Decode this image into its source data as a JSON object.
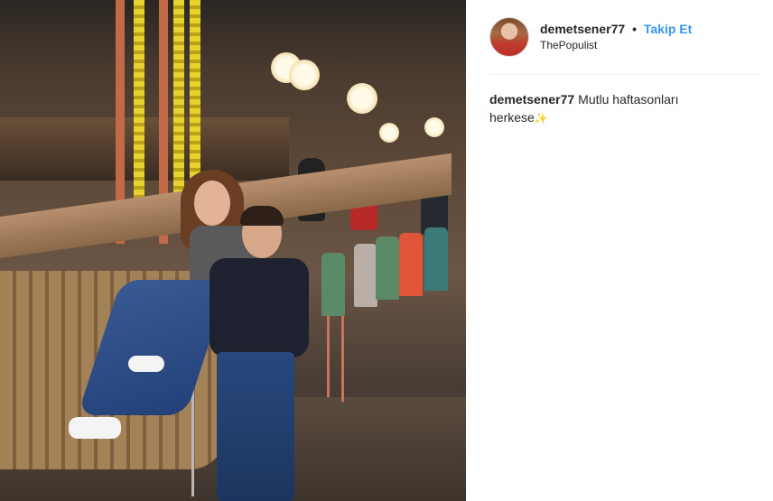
{
  "post": {
    "username": "demetsener77",
    "separator": "•",
    "follow_label": "Takip Et",
    "location": "ThePopulist",
    "caption": {
      "username": "demetsener77",
      "text": "Mutlu haftasonları herkese",
      "emoji": "✨"
    }
  },
  "colors": {
    "follow": "#3897f0",
    "text": "#262626",
    "divider": "#efefef"
  },
  "icons": {
    "avatar": "profile-avatar",
    "caption_emoji": "sparkles-icon"
  }
}
